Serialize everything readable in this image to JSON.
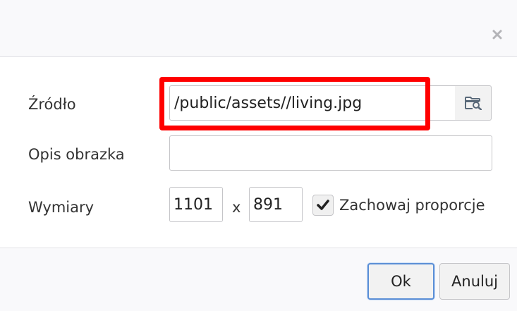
{
  "dialog": {
    "close_icon": "close-icon",
    "source": {
      "label": "Źródło",
      "value": "/public/assets//living.jpg",
      "browse_icon": "browse-icon"
    },
    "description": {
      "label": "Opis obrazka",
      "value": ""
    },
    "dimensions": {
      "label": "Wymiary",
      "width": "1101",
      "separator": "x",
      "height": "891",
      "constrain_label": "Zachowaj proporcje",
      "constrain_checked": true
    },
    "buttons": {
      "ok": "Ok",
      "cancel": "Anuluj"
    }
  },
  "colors": {
    "highlight": "#ff0000",
    "primary_border": "#5b8fd6"
  }
}
